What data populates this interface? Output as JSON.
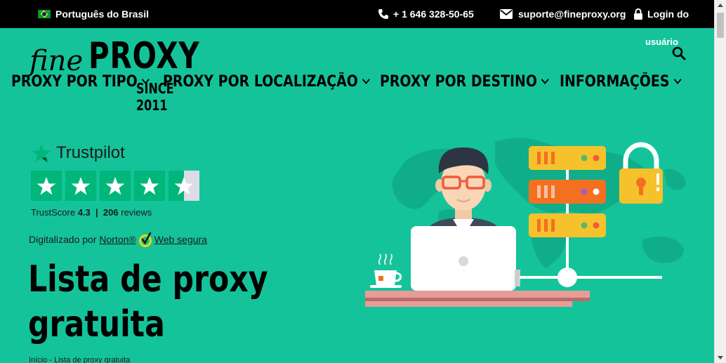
{
  "topbar": {
    "language": "Português do Brasil",
    "phone": "+ 1 646 328-50-65",
    "email": "suporte@fineproxy.org",
    "login": "Login do",
    "user": "usuário"
  },
  "logo": {
    "fine": "fine",
    "proxy": "PROXY",
    "since": "SINCE 2011"
  },
  "nav": {
    "items": [
      {
        "label": "PROXY POR TIPO"
      },
      {
        "label": "PROXY POR LOCALIZAÇÃO"
      },
      {
        "label": "PROXY POR DESTINO"
      },
      {
        "label": "INFORMAÇÕES"
      }
    ]
  },
  "trustpilot": {
    "brand": "Trustpilot",
    "score_label": "TrustScore",
    "score": "4.3",
    "separator": "|",
    "reviews": "206",
    "reviews_label": "reviews",
    "rating": 4.3,
    "max_rating": 5
  },
  "norton": {
    "prefix": "Digitalizado por",
    "brand": "Norton®",
    "link": "Web segura"
  },
  "main": {
    "title_line1": "Lista de proxy",
    "title_line2": "gratuita",
    "breadcrumb": "Início - Lista de proxy gratuita"
  },
  "colors": {
    "brand_green": "#15c39a",
    "topbar_bg": "#000000",
    "trustpilot_green": "#00b67a",
    "server_yellow": "#f6c22c",
    "server_orange": "#f37021"
  },
  "icons": {
    "flag": "brazil-flag-icon",
    "phone": "phone-icon",
    "email": "envelope-icon",
    "login": "lock-icon",
    "search": "search-icon"
  }
}
